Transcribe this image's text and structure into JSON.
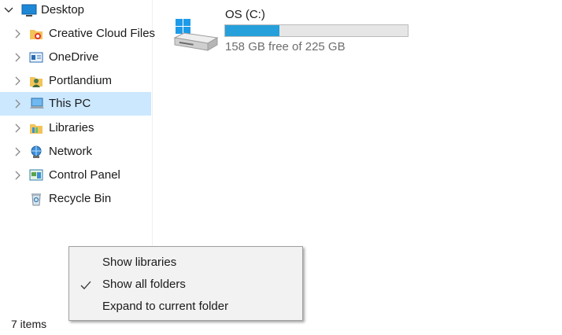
{
  "nav_pane": {
    "items": [
      {
        "label": "Desktop",
        "icon": "desktop-icon",
        "expanded": true
      },
      {
        "label": "Creative Cloud Files",
        "icon": "creative-cloud-folder-icon"
      },
      {
        "label": "OneDrive",
        "icon": "onedrive-icon"
      },
      {
        "label": "Portlandium",
        "icon": "user-folder-icon"
      },
      {
        "label": "This PC",
        "icon": "this-pc-icon",
        "selected": true
      },
      {
        "label": "Libraries",
        "icon": "libraries-icon"
      },
      {
        "label": "Network",
        "icon": "network-icon"
      },
      {
        "label": "Control Panel",
        "icon": "control-panel-icon"
      },
      {
        "label": "Recycle Bin",
        "icon": "recycle-bin-icon"
      }
    ]
  },
  "drive": {
    "name": "OS (C:)",
    "free_text": "158 GB free of 225 GB",
    "used_fraction": 0.298,
    "bar_color": "#26a0da"
  },
  "status_bar": {
    "item_count": "7 items"
  },
  "context_menu": {
    "items": [
      {
        "label": "Show libraries",
        "checked": false
      },
      {
        "label": "Show all folders",
        "checked": true
      },
      {
        "label": "Expand to current folder",
        "checked": false
      }
    ]
  },
  "colors": {
    "selection": "#cce8ff",
    "accent": "#26a0da"
  }
}
